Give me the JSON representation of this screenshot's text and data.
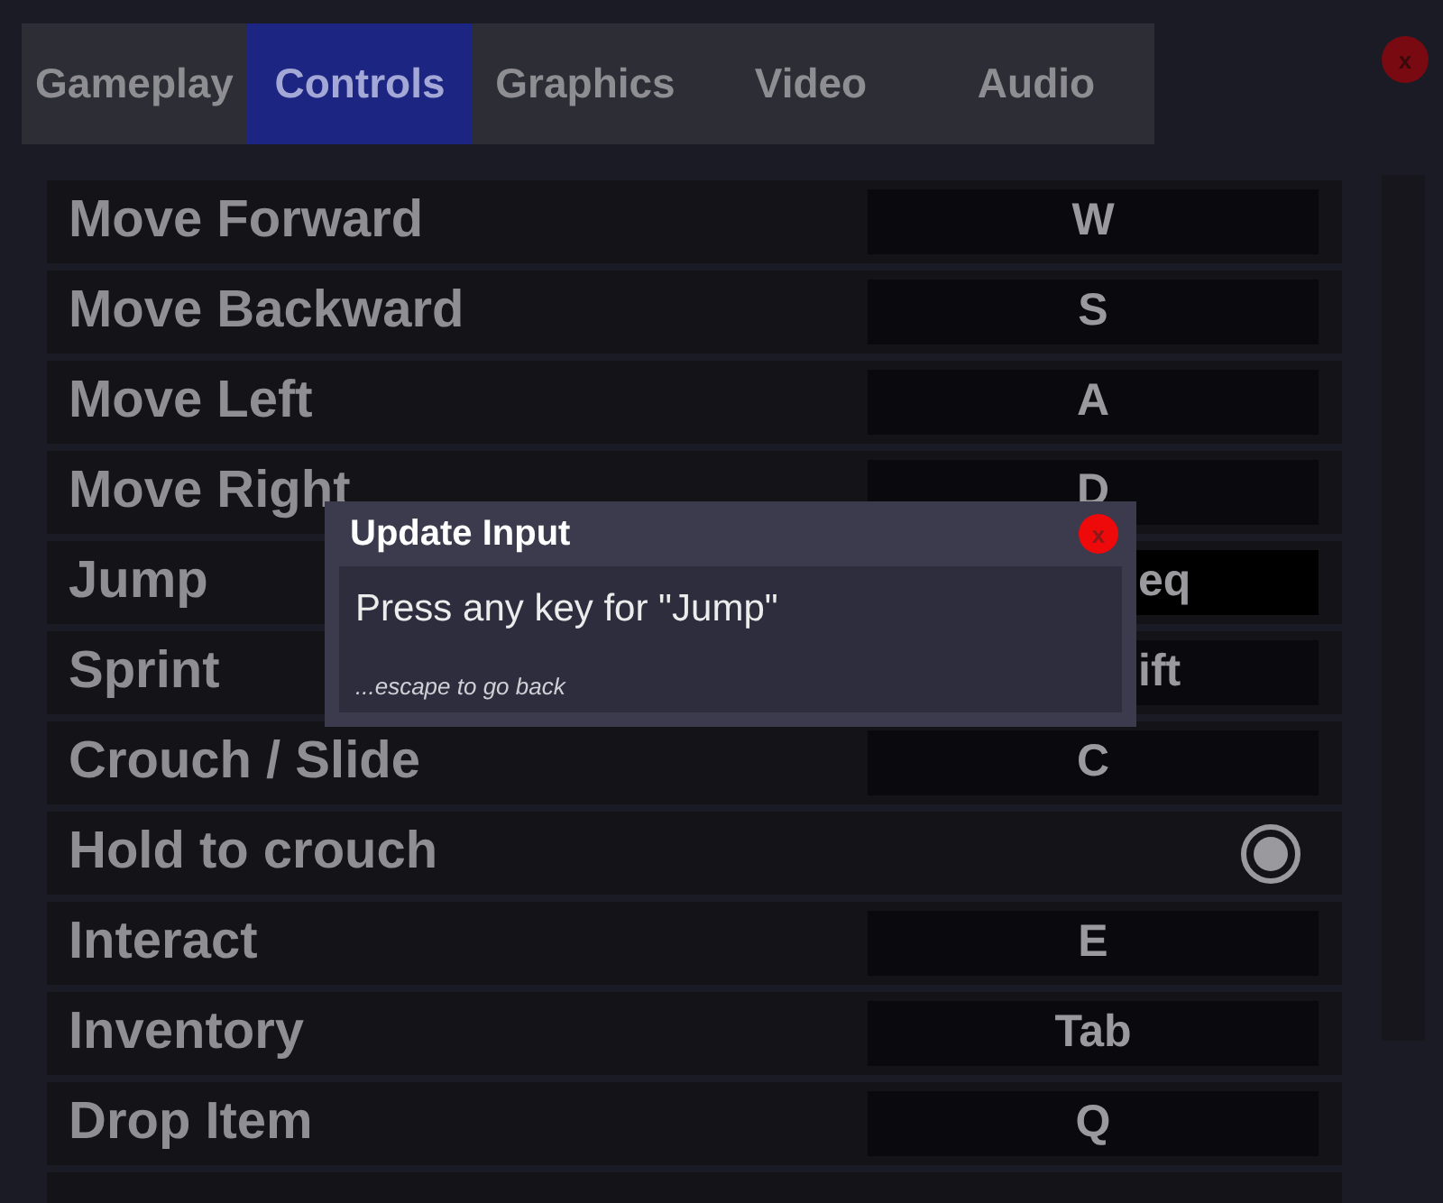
{
  "tabs": [
    {
      "label": "Gameplay",
      "selected": false
    },
    {
      "label": "Controls",
      "selected": true
    },
    {
      "label": "Graphics",
      "selected": false
    },
    {
      "label": "Video",
      "selected": false
    },
    {
      "label": "Audio",
      "selected": false
    }
  ],
  "close_icon": "x",
  "rows": [
    {
      "kind": "key",
      "label": "Move Forward",
      "key": "W",
      "selected": false
    },
    {
      "kind": "key",
      "label": "Move Backward",
      "key": "S",
      "selected": false
    },
    {
      "kind": "key",
      "label": "Move Left",
      "key": "A",
      "selected": false
    },
    {
      "kind": "key",
      "label": "Move Right",
      "key": "D",
      "selected": false
    },
    {
      "kind": "key",
      "label": "Jump",
      "key": "eq",
      "selected": true,
      "partly_hidden": true
    },
    {
      "kind": "key",
      "label": "Sprint",
      "key": "ift",
      "selected": false,
      "partly_hidden": true
    },
    {
      "kind": "key",
      "label": "Crouch / Slide",
      "key": "C",
      "selected": false
    },
    {
      "kind": "toggle",
      "label": "Hold to crouch",
      "checked": true
    },
    {
      "kind": "key",
      "label": "Interact",
      "key": "E",
      "selected": false
    },
    {
      "kind": "key",
      "label": "Inventory",
      "key": "Tab",
      "selected": false
    },
    {
      "kind": "key",
      "label": "Drop Item",
      "key": "Q",
      "selected": false
    }
  ],
  "dialog": {
    "title": "Update Input",
    "close_icon": "x",
    "message": "Press any key for \"Jump\"",
    "hint": "...escape to go back"
  }
}
